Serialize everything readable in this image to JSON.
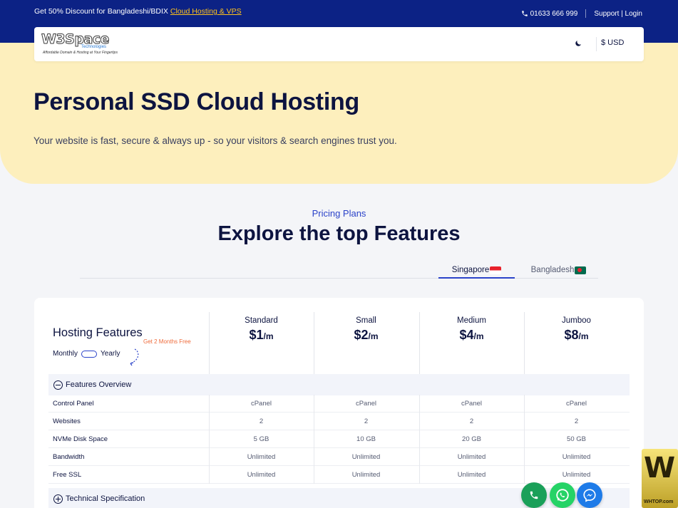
{
  "topbar": {
    "promo_text": "Get 50% Discount for Bangladeshi/BDIX ",
    "promo_link": "Cloud Hosting & VPS",
    "phone": "01633 666 999",
    "support_login": "Support | Login"
  },
  "nav": {
    "logo_text": "W3Space",
    "logo_sub": "Technologies",
    "logo_tagline": "Affordable Domain & Hosting at Your Fingertips",
    "currency": "$ USD"
  },
  "hero": {
    "title": "Personal SSD Cloud Hosting",
    "subtitle": "Your website is fast, secure & always up - so your visitors & search engines trust you."
  },
  "section": {
    "eyebrow": "Pricing Plans",
    "title": "Explore the top Features"
  },
  "tabs": [
    {
      "label": "Singapore",
      "active": true
    },
    {
      "label": "Bangladesh",
      "active": false
    }
  ],
  "pricing": {
    "heading": "Hosting Features",
    "monthly": "Monthly",
    "yearly": "Yearly",
    "promo": "Get 2 Months Free",
    "per": "/m",
    "plans": [
      {
        "name": "Standard",
        "price": "$1"
      },
      {
        "name": "Small",
        "price": "$2"
      },
      {
        "name": "Medium",
        "price": "$4"
      },
      {
        "name": "Jumboo",
        "price": "$8"
      }
    ],
    "group_overview": "Features Overview",
    "group_tech": "Technical Specification",
    "rows": [
      {
        "label": "Control Panel",
        "values": [
          "cPanel",
          "cPanel",
          "cPanel",
          "cPanel"
        ]
      },
      {
        "label": "Websites",
        "values": [
          "2",
          "2",
          "2",
          "2"
        ]
      },
      {
        "label": "NVMe Disk Space",
        "values": [
          "5 GB",
          "10 GB",
          "20 GB",
          "50 GB"
        ]
      },
      {
        "label": "Bandwidth",
        "values": [
          "Unlimited",
          "Unlimited",
          "Unlimited",
          "Unlimited"
        ]
      },
      {
        "label": "Free SSL",
        "values": [
          "Unlimited",
          "Unlimited",
          "Unlimited",
          "Unlimited"
        ]
      }
    ]
  },
  "watermark": {
    "big": "W",
    "small": "WHTOP.com"
  },
  "colors": {
    "topbar": "#0c2285",
    "hero": "#fdefbd",
    "accent": "#2b43c9",
    "promo": "#ef6b3b"
  },
  "icons": [
    "phone-icon",
    "moon-icon",
    "minus-circle-icon",
    "plus-circle-icon",
    "call-icon",
    "whatsapp-icon",
    "messenger-icon"
  ]
}
